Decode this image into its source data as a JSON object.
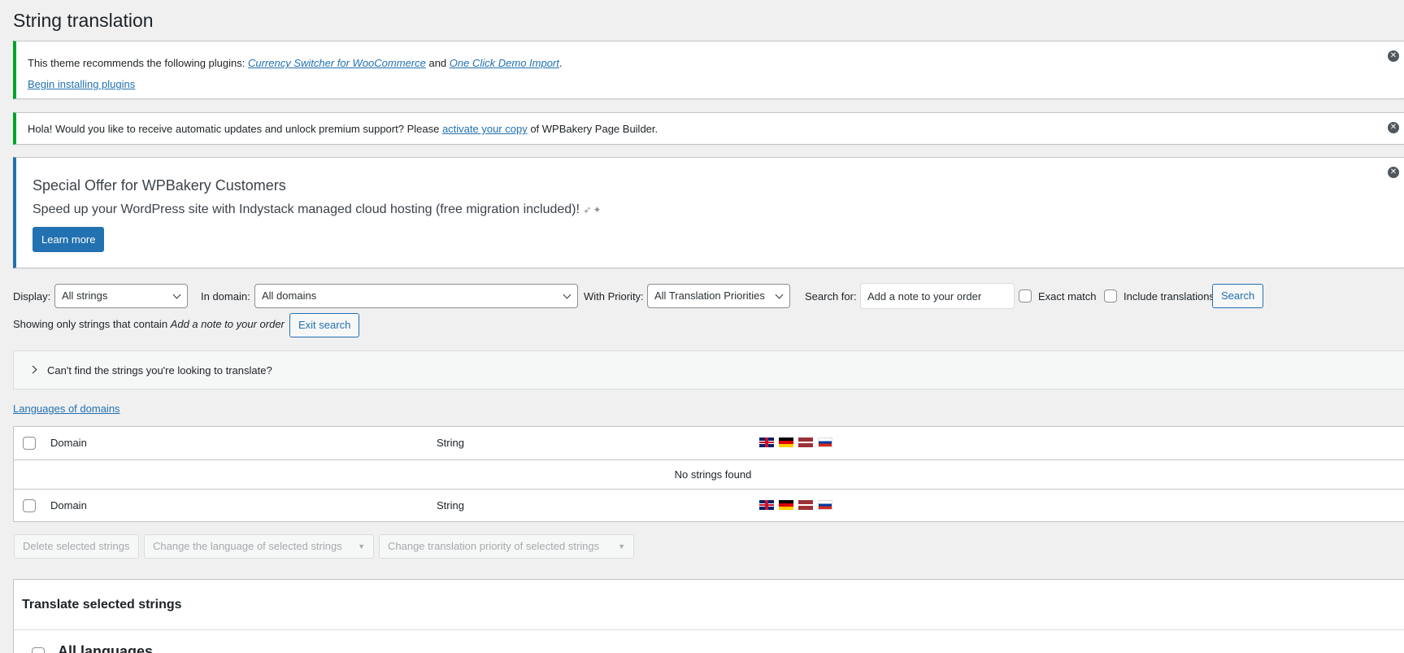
{
  "page": {
    "title": "String translation"
  },
  "notice_plugins": {
    "prefix": "This theme recommends the following plugins: ",
    "plugin1": "Currency Switcher for WooCommerce",
    "and": " and ",
    "plugin2": "One Click Demo Import",
    "suffix": ".",
    "install_link": "Begin installing plugins"
  },
  "notice_wpbakery": {
    "prefix": "Hola! Would you like to receive automatic updates and unlock premium support? Please ",
    "link": "activate your copy",
    "suffix": " of WPBakery Page Builder."
  },
  "notice_offer": {
    "title": "Special Offer for WPBakery Customers",
    "desc": "Speed up your WordPress site with Indystack managed cloud hosting (free migration included)!",
    "button": "Learn more"
  },
  "filters": {
    "display_label": "Display:",
    "display_value": "All strings",
    "domain_label": "In domain:",
    "domain_value": "All domains",
    "priority_label": "With Priority:",
    "priority_value": "All Translation Priorities",
    "search_label": "Search for:",
    "search_value": "Add a note to your order",
    "exact_match": "Exact match",
    "include_translations": "Include translations",
    "search_button": "Search"
  },
  "showing": {
    "prefix": "Showing only strings that contain ",
    "query": "Add a note to your order",
    "exit_button": "Exit search"
  },
  "help_toggle": "Can't find the strings you're looking to translate?",
  "languages_link": "Languages of domains",
  "table": {
    "col_domain": "Domain",
    "col_string": "String",
    "flags": [
      "gb-flag-icon",
      "de-flag-icon",
      "lv-flag-icon",
      "ru-flag-icon"
    ],
    "empty": "No strings found"
  },
  "bulk": {
    "delete": "Delete selected strings",
    "change_language": "Change the language of selected strings",
    "change_priority": "Change translation priority of selected strings"
  },
  "translate_panel": {
    "title": "Translate selected strings",
    "all_languages": "All languages"
  },
  "colors": {
    "accent": "#2271b1",
    "success": "#00a32a",
    "background": "#f0f0f1"
  }
}
